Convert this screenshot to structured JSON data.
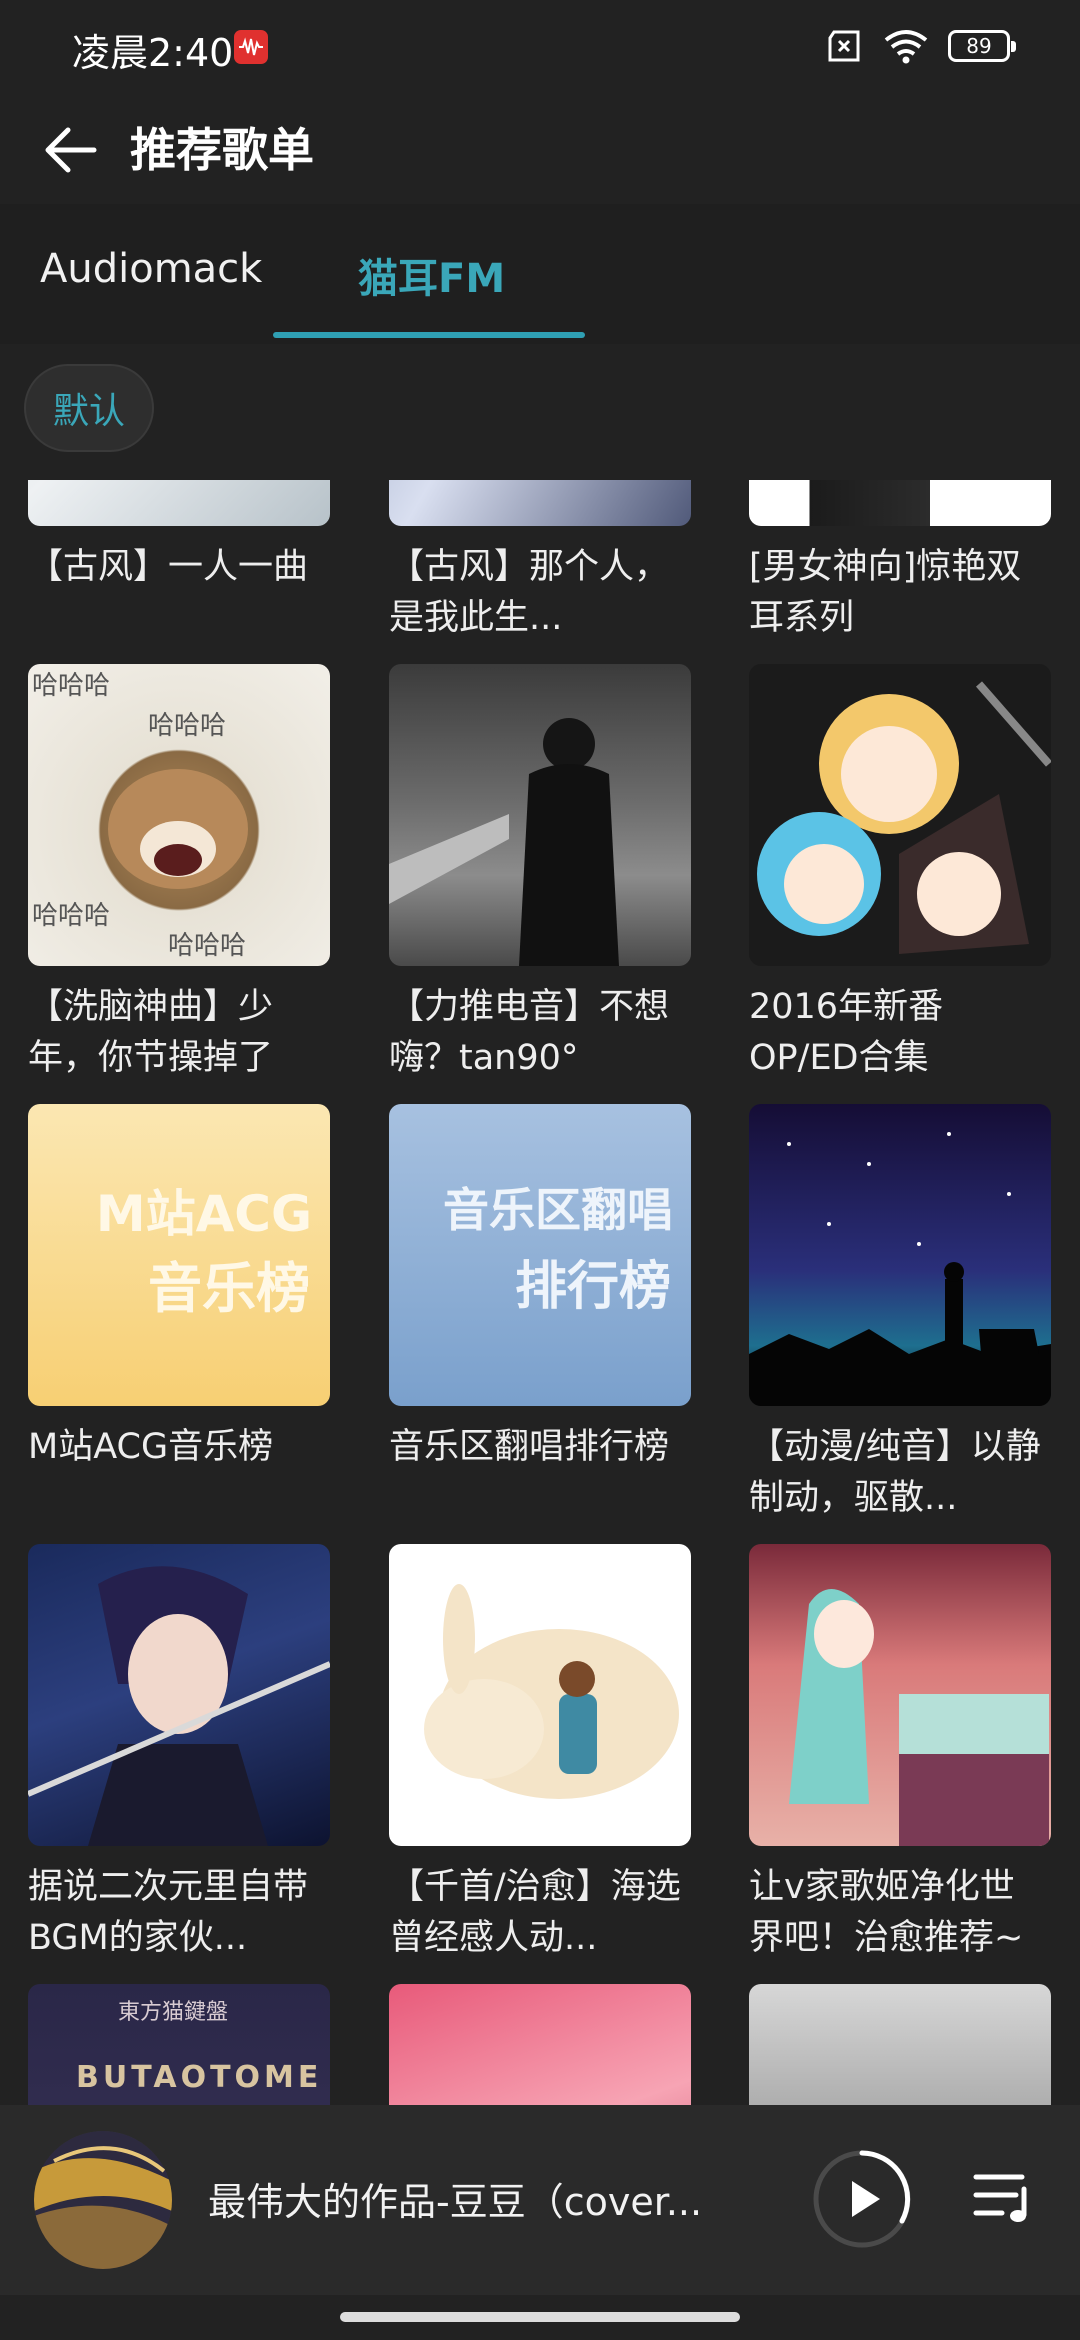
{
  "status_bar": {
    "time": "凌晨2:40",
    "battery": "89"
  },
  "header": {
    "title": "推荐歌单"
  },
  "tabs": [
    {
      "label": "Audiomack",
      "active": false
    },
    {
      "label": "猫耳FM",
      "active": true
    }
  ],
  "filter_chip": "默认",
  "playlists": [
    {
      "title": "【古风】一人一曲"
    },
    {
      "title": "【古风】那个人，是我此生..."
    },
    {
      "title": "[男女神向]惊艳双耳系列"
    },
    {
      "title": "【洗脑神曲】少年，你节操掉了"
    },
    {
      "title": "【力推电音】不想嗨？tan90°"
    },
    {
      "title": "2016年新番OP/ED合集"
    },
    {
      "title": "M站ACG音乐榜",
      "cover_text": [
        "M站ACG",
        "音乐榜"
      ]
    },
    {
      "title": "音乐区翻唱排行榜",
      "cover_text": [
        "音乐区翻唱",
        "排行榜"
      ]
    },
    {
      "title": "【动漫/纯音】以静制动，驱散..."
    },
    {
      "title": "据说二次元里自带BGM的家伙..."
    },
    {
      "title": "【千首/治愈】海选曾经感人动..."
    },
    {
      "title": "让v家歌姬净化世界吧！治愈推荐~"
    },
    {
      "title": "",
      "cover_text": [
        "東方猫鍵盤",
        "BUTAOTOME"
      ]
    },
    {
      "title": ""
    },
    {
      "title": ""
    }
  ],
  "cover_overlay_text": "哈哈哈",
  "player": {
    "song": "最伟大的作品-豆豆（cover..."
  },
  "colors": {
    "accent": "#3aa7b9",
    "background": "#222222"
  }
}
